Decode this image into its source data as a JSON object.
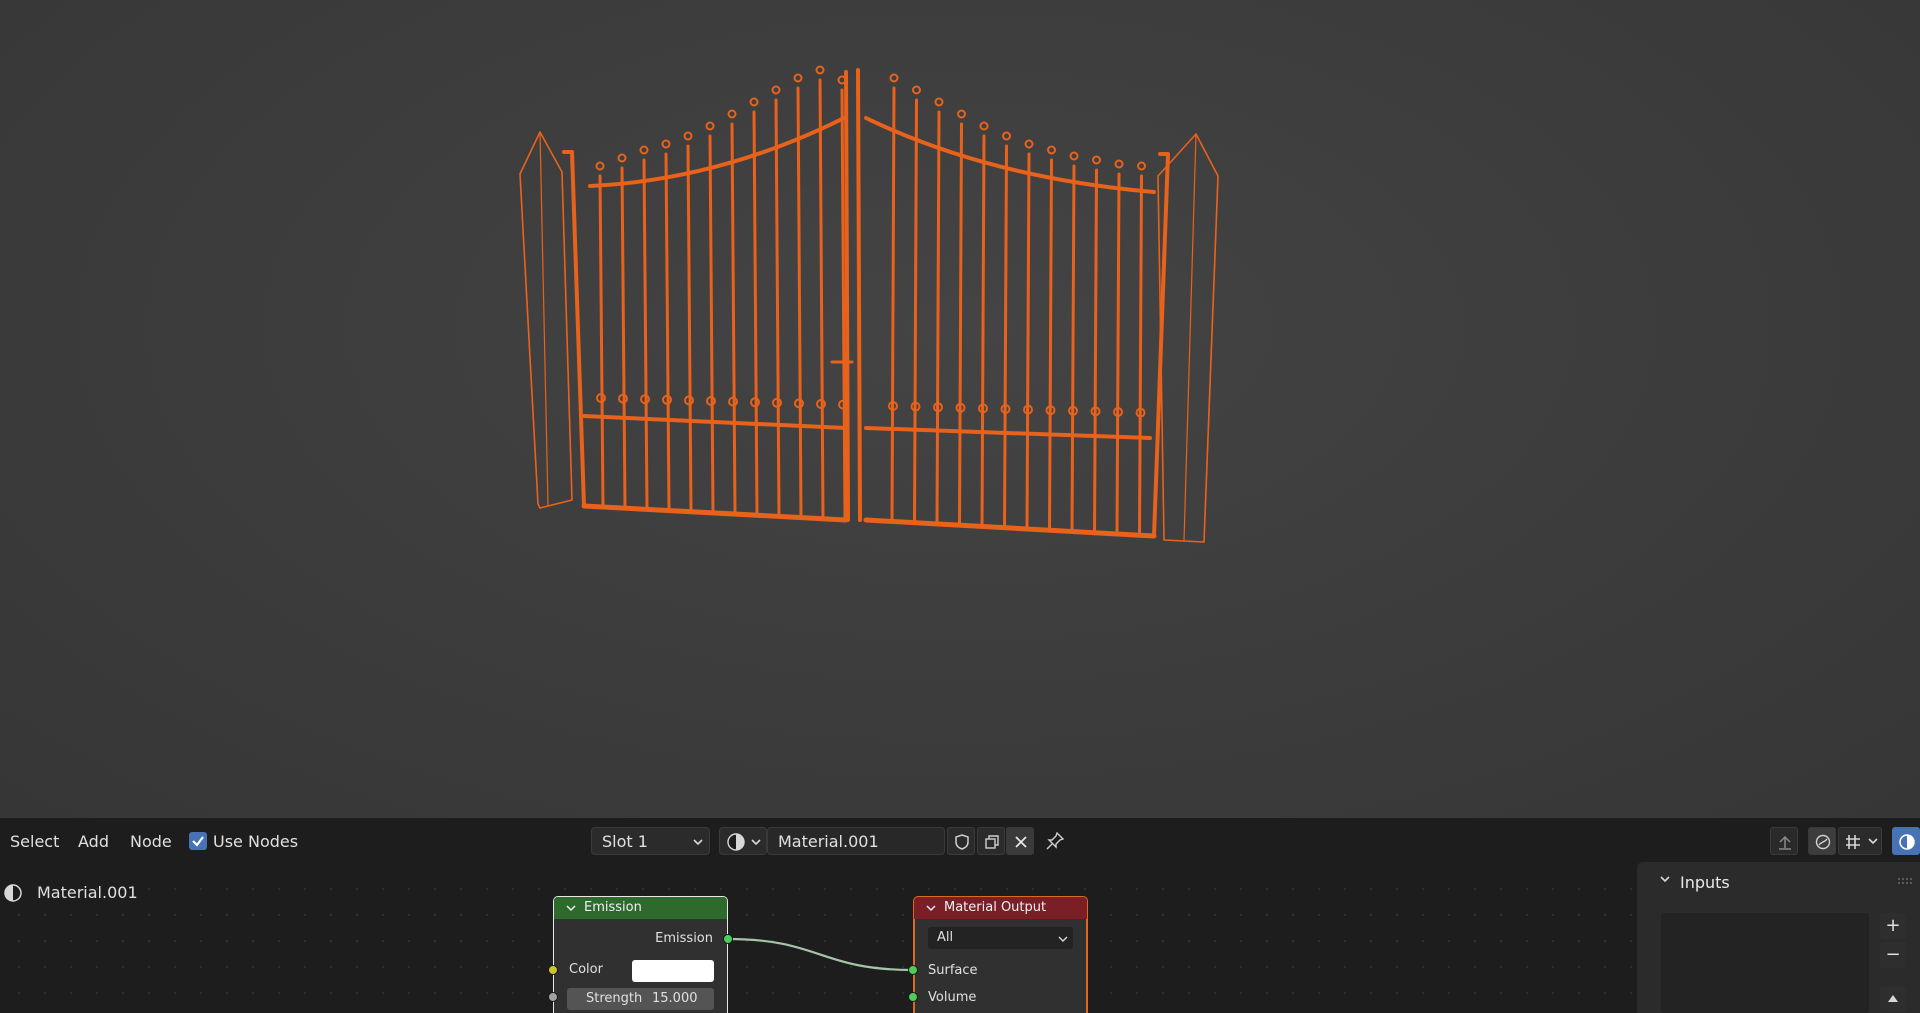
{
  "header": {
    "menu_select": "Select",
    "menu_add": "Add",
    "menu_node": "Node",
    "use_nodes_label": "Use Nodes",
    "use_nodes_checked": true,
    "slot_value": "Slot 1",
    "material_name": "Material.001",
    "icons": [
      "material-sphere-icon",
      "fake-user-shield-icon",
      "duplicate-material-icon",
      "unlink-x-icon",
      "pin-icon",
      "parent-node-tree-icon",
      "overlay-icon",
      "snapping-grid-icon",
      "viewport-shading-icon"
    ]
  },
  "breadcrumb": {
    "material_name": "Material.001"
  },
  "nodes": {
    "emission": {
      "title": "Emission",
      "output_label": "Emission",
      "color_label": "Color",
      "color_value": "#ffffff",
      "strength_label": "Strength",
      "strength_value": "15.000",
      "header_color": "#2f6a2d"
    },
    "material_output": {
      "title": "Material Output",
      "target_value": "All",
      "surface_label": "Surface",
      "volume_label": "Volume",
      "header_color": "#7a1f26"
    }
  },
  "sidebar": {
    "panel_title": "Inputs",
    "add_label": "+",
    "remove_label": "−"
  },
  "colors": {
    "selection_orange": "#e8621b",
    "accent_blue": "#4772b3",
    "socket_green": "#4dcc5a",
    "socket_yellow": "#c7c729",
    "socket_gray": "#a1a1a1"
  }
}
